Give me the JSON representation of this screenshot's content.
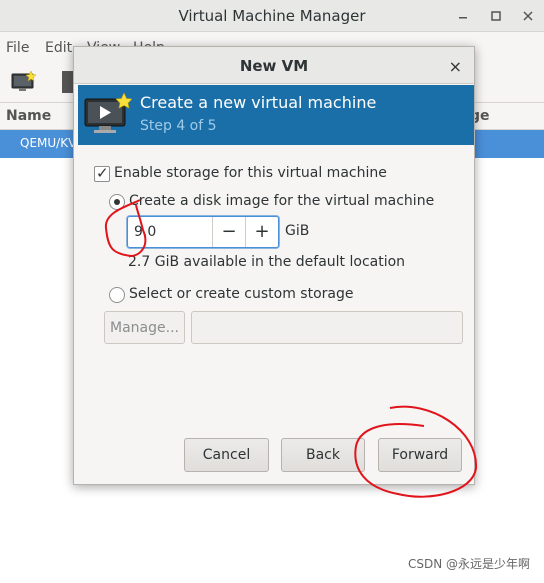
{
  "main_window": {
    "title": "Virtual Machine Manager",
    "menu": [
      "File",
      "Edit",
      "View",
      "Help"
    ],
    "column_name": "Name",
    "column_right_fragment": "ge",
    "selected_row": "QEMU/KV"
  },
  "dialog": {
    "title": "New VM",
    "close_glyph": "×",
    "banner_title": "Create a new virtual machine",
    "banner_step": "Step 4 of 5",
    "enable_storage_label": "Enable storage for this virtual machine",
    "enable_storage_checked": true,
    "create_disk_label": "Create a disk image for the virtual machine",
    "disk_size_value": "9.0",
    "decrement_glyph": "−",
    "increment_glyph": "+",
    "unit": "GiB",
    "available_text": "2.7 GiB available in the default location",
    "custom_storage_label": "Select or create custom storage",
    "manage_label": "Manage...",
    "custom_storage_value": "",
    "cancel_label": "Cancel",
    "back_label": "Back",
    "forward_label": "Forward"
  },
  "watermark": "CSDN @永远是少年啊",
  "colors": {
    "banner": "#1b6fa8",
    "selection": "#4a90d9",
    "annotation": "#e0141a"
  }
}
